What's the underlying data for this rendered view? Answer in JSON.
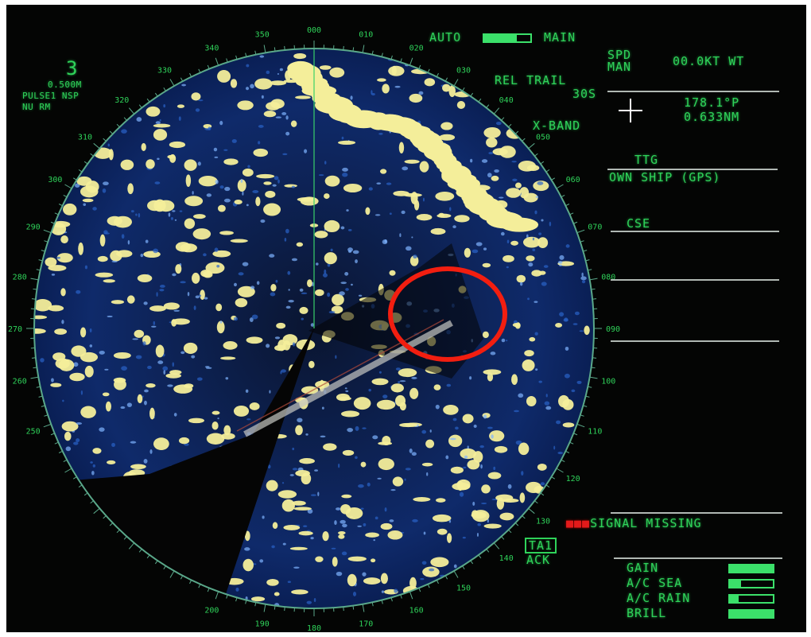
{
  "range": {
    "scale": "3",
    "ring_interval": "0.500M",
    "pulse": "PULSE1 NSP",
    "motion": "NU RM"
  },
  "mode": {
    "auto_label": "AUTO",
    "main_label": "MAIN",
    "auto_main_level": 0.7
  },
  "speed": {
    "label_line1": "SPD",
    "label_line2": "MAN",
    "value": "00.0KT WT"
  },
  "trail": {
    "label": "REL TRAIL",
    "value": "30S"
  },
  "cursor": {
    "bearing": "178.1°P",
    "range": "0.633NM"
  },
  "band": "X-BAND",
  "ship": {
    "ttg_label": "TTG",
    "own_ship_label": "OWN SHIP (GPS)",
    "cse_label": "CSE"
  },
  "alarm": {
    "marker": "■■■",
    "text": "SIGNAL MISSING",
    "tag_line1": "TA1",
    "tag_line2": "ACK"
  },
  "controls": [
    {
      "label": "GAIN",
      "level": 1.0
    },
    {
      "label": "A/C SEA",
      "level": 0.25
    },
    {
      "label": "A/C RAIN",
      "level": 0.2
    },
    {
      "label": "BRILL",
      "level": 1.0
    }
  ],
  "bearing_scale": [
    {
      "label": "000",
      "deg": 0
    },
    {
      "label": "010",
      "deg": 10
    },
    {
      "label": "020",
      "deg": 20
    },
    {
      "label": "030",
      "deg": 30
    },
    {
      "label": "040",
      "deg": 40
    },
    {
      "label": "050",
      "deg": 50
    },
    {
      "label": "060",
      "deg": 60
    },
    {
      "label": "070",
      "deg": 70
    },
    {
      "label": "080",
      "deg": 80
    },
    {
      "label": "090",
      "deg": 90
    },
    {
      "label": "100",
      "deg": 100
    },
    {
      "label": "110",
      "deg": 110
    },
    {
      "label": "120",
      "deg": 120
    },
    {
      "label": "130",
      "deg": 130
    },
    {
      "label": "140",
      "deg": 140
    },
    {
      "label": "150",
      "deg": 150
    },
    {
      "label": "160",
      "deg": 160
    },
    {
      "label": "170",
      "deg": 170
    },
    {
      "label": "180",
      "deg": 180
    },
    {
      "label": "190",
      "deg": 190
    },
    {
      "label": "200",
      "deg": 200
    },
    {
      "label": "250",
      "deg": 250
    },
    {
      "label": "260",
      "deg": 260
    },
    {
      "label": "270",
      "deg": 270
    },
    {
      "label": "280",
      "deg": 280
    },
    {
      "label": "290",
      "deg": 290
    },
    {
      "label": "300",
      "deg": 300
    },
    {
      "label": "310",
      "deg": 310
    },
    {
      "label": "320",
      "deg": 320
    },
    {
      "label": "330",
      "deg": 330
    },
    {
      "label": "340",
      "deg": 340
    },
    {
      "label": "350",
      "deg": 350
    }
  ],
  "colors": {
    "text": "#2fd35a",
    "echo_strong": "#f4ee9a",
    "echo_weak": "#2a63c8",
    "alarm": "#e21a1a",
    "highlight_ring": "#f21e10"
  }
}
